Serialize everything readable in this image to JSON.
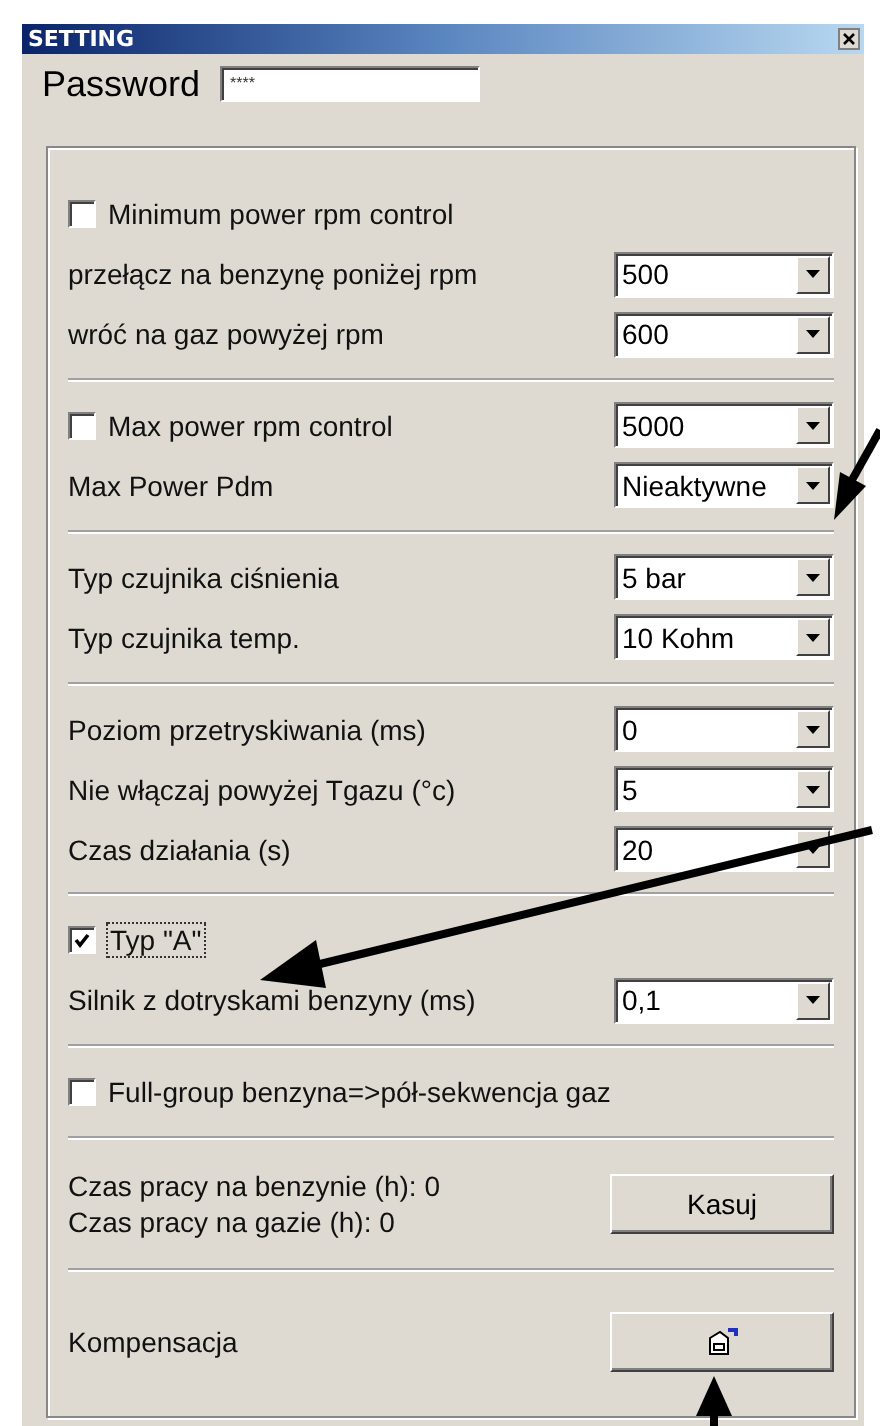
{
  "window": {
    "title": "SETTING"
  },
  "password": {
    "label": "Password",
    "value": "****"
  },
  "sections": [
    {
      "rows": [
        {
          "kind": "check",
          "label": "Minimum power rpm control",
          "checked": false
        },
        {
          "kind": "combo",
          "label": "przełącz na benzynę poniżej rpm",
          "value": "500"
        },
        {
          "kind": "combo",
          "label": "wróć na gaz powyżej rpm",
          "value": "600"
        }
      ]
    },
    {
      "rows": [
        {
          "kind": "check-combo",
          "label": "Max power rpm control",
          "checked": false,
          "value": "5000"
        },
        {
          "kind": "combo",
          "label": "Max Power Pdm",
          "value": "Nieaktywne"
        }
      ]
    },
    {
      "rows": [
        {
          "kind": "combo",
          "label": "Typ czujnika ciśnienia",
          "value": "5 bar"
        },
        {
          "kind": "combo",
          "label": "Typ czujnika temp.",
          "value": "10 Kohm"
        }
      ]
    },
    {
      "rows": [
        {
          "kind": "combo",
          "label": "Poziom przetryskiwania (ms)",
          "value": "0"
        },
        {
          "kind": "combo",
          "label": "Nie włączaj powyżej Tgazu (°c)",
          "value": "5"
        },
        {
          "kind": "combo",
          "label": "Czas działania (s)",
          "value": "20"
        }
      ]
    },
    {
      "rows": [
        {
          "kind": "check",
          "label": "Typ \"A\"",
          "checked": true
        },
        {
          "kind": "combo",
          "label": "Silnik z dotryskami benzyny (ms)",
          "value": "0,1"
        }
      ]
    },
    {
      "rows": [
        {
          "kind": "check",
          "label": "Full-group benzyna=>pół-sekwencja gaz",
          "checked": false
        }
      ]
    },
    {
      "rows": [
        {
          "kind": "counters",
          "lines": [
            "Czas pracy na benzynie (h): 0",
            "Czas pracy na gazie (h): 0"
          ],
          "button": "Kasuj"
        }
      ]
    },
    {
      "rows": [
        {
          "kind": "icon-button",
          "label": "Kompensacja"
        }
      ]
    }
  ]
}
